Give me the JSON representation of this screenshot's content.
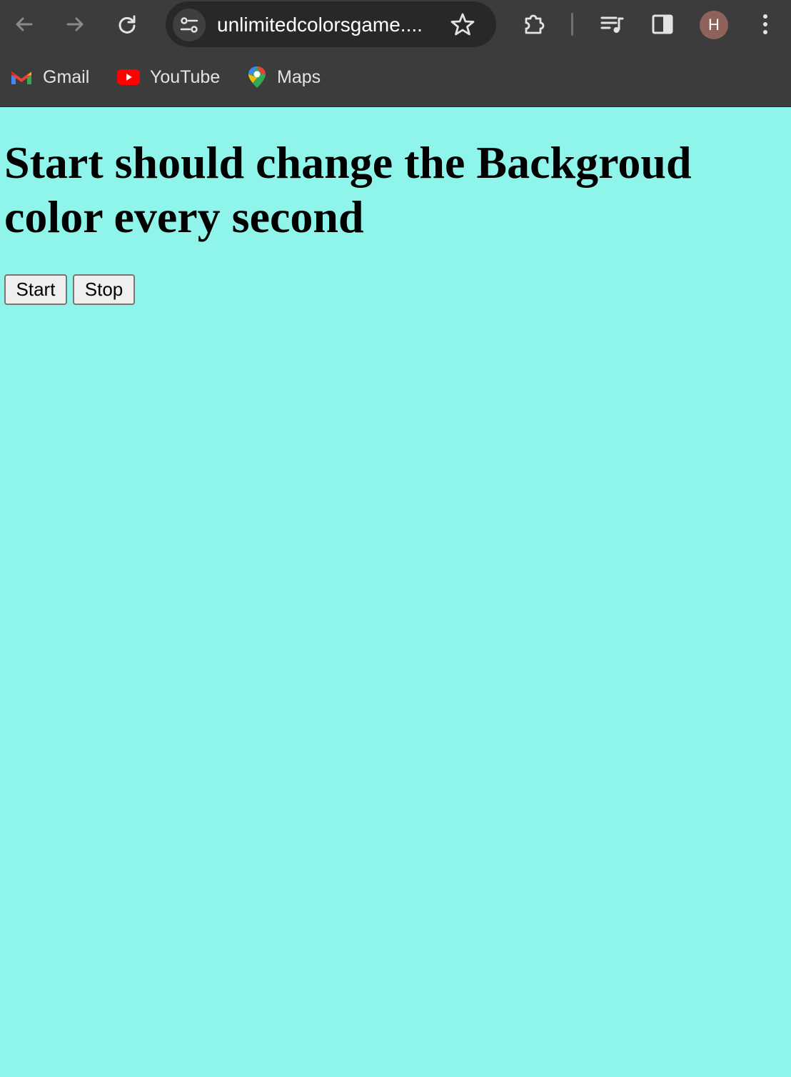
{
  "browser": {
    "url": "unlimitedcolorsgame....",
    "profile_initial": "H",
    "bookmarks": [
      {
        "label": "Gmail",
        "icon": "gmail-icon"
      },
      {
        "label": "YouTube",
        "icon": "youtube-icon"
      },
      {
        "label": "Maps",
        "icon": "maps-icon"
      }
    ],
    "icons": [
      "back-icon",
      "forward-icon",
      "reload-icon",
      "site-info-icon",
      "star-icon",
      "extensions-icon",
      "media-icon",
      "side-panel-icon",
      "menu-icon"
    ]
  },
  "page": {
    "heading": "Start should change the Backgroud color every second",
    "start_label": "Start",
    "stop_label": "Stop",
    "background_color": "#8ff5ea"
  }
}
